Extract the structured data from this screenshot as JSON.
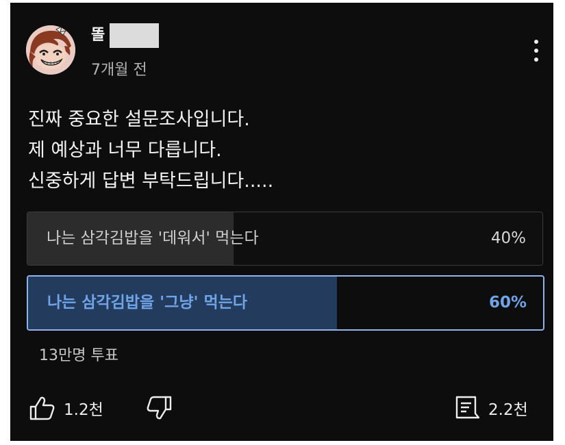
{
  "post": {
    "author": "똘",
    "time": "7개월 전",
    "body_lines": [
      "진짜 중요한 설문조사입니다.",
      "제 예상과 너무 다릅니다.",
      "신중하게 답변 부탁드립니다....."
    ]
  },
  "poll": {
    "options": [
      {
        "label": "나는 삼각김밥을 '데워서' 먹는다",
        "percent_label": "40%",
        "percent": 40,
        "selected": false
      },
      {
        "label": "나는 삼각김밥을 '그냥' 먹는다",
        "percent_label": "60%",
        "percent": 60,
        "selected": true
      }
    ],
    "votes": "13만명 투표"
  },
  "actions": {
    "likes": "1.2천",
    "comments": "2.2천"
  },
  "icons": {
    "like": "thumbs-up-icon",
    "dislike": "thumbs-down-icon",
    "comments": "comment-icon",
    "menu": "more-vert-icon"
  },
  "colors": {
    "background": "#0d0d0d",
    "selected_accent": "#70a4e8",
    "selected_fill": "#233b5c",
    "unselected_fill": "#2c2c2c"
  }
}
